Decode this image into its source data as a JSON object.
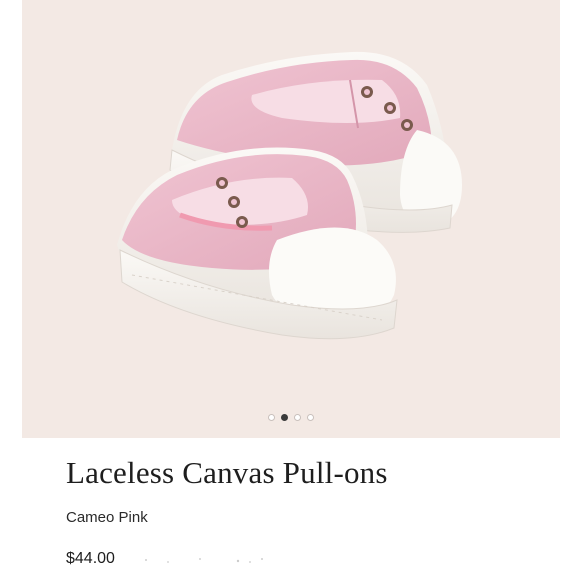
{
  "product": {
    "title": "Laceless Canvas Pull-ons",
    "color": "Cameo Pink",
    "price": "$44.00"
  },
  "gallery": {
    "image_count": 4,
    "active_index": 1,
    "image_subject": "pink slip-on canvas sneakers",
    "image_alt": "Pink laceless canvas pull-on shoes with white rubber toe caps",
    "background_color": "#f3e9e4",
    "shoe_color": "#eab8c8",
    "sole_color": "#f7f4f0"
  }
}
